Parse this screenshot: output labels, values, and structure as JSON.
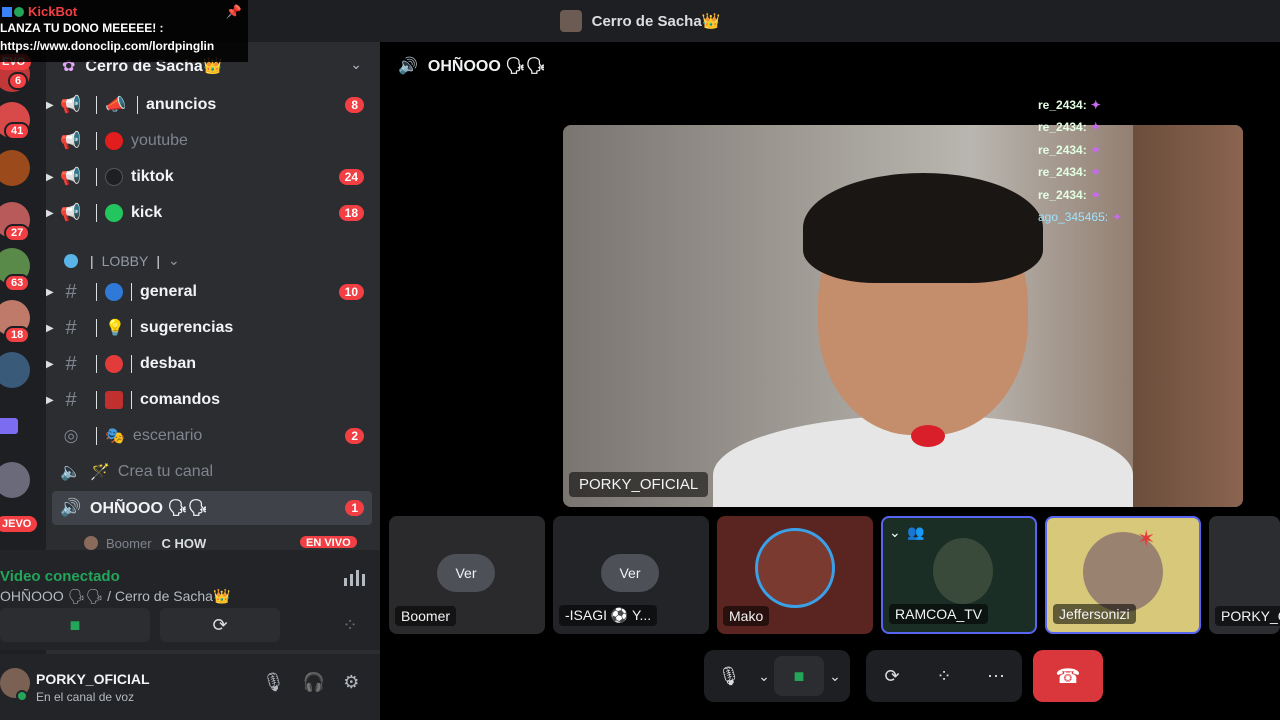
{
  "window": {
    "title": "Cerro de Sacha👑"
  },
  "kickbot": {
    "name": "KickBot",
    "line1": "LANZA TU DONO MEEEEE! :",
    "line2": "https://www.donoclip.com/lordpinglin"
  },
  "rail": {
    "badges": [
      "6",
      "41",
      "27",
      "63",
      "18"
    ],
    "nuevo_top": "EVO",
    "nuevo_bottom": "JEVO"
  },
  "sidebar": {
    "guild_name": "Cerro de Sacha👑",
    "lobby_label": "LOBBY",
    "channels": [
      {
        "name": "anuncios",
        "count": "8"
      },
      {
        "name": "youtube",
        "count": ""
      },
      {
        "name": "tiktok",
        "count": "24"
      },
      {
        "name": "kick",
        "count": "18"
      },
      {
        "name": "general",
        "count": "10"
      },
      {
        "name": "sugerencias",
        "count": ""
      },
      {
        "name": "desban",
        "count": ""
      },
      {
        "name": "comandos",
        "count": ""
      },
      {
        "name": "escenario",
        "count": "2"
      },
      {
        "name": "Crea tu canal",
        "count": ""
      },
      {
        "name": "OHÑOOO 🗣🗣",
        "count": "1"
      }
    ],
    "sub_item": "Boomer",
    "sub_item_game": "C HOW",
    "envivo": "EN VIVO"
  },
  "voice_panel": {
    "status": "Video conectado",
    "location": "OHÑOOO 🗣🗣 / Cerro de Sacha👑"
  },
  "user_panel": {
    "username": "PORKY_OFICIAL",
    "status": "En el canal de voz"
  },
  "stage": {
    "channel_title": "OHÑOOO 🗣🗣",
    "chat": [
      {
        "user": "re_2434:"
      },
      {
        "user": "re_2434:"
      },
      {
        "user": "re_2434:"
      },
      {
        "user": "re_2434:"
      },
      {
        "user": "re_2434:"
      },
      {
        "user": "ago_345465:"
      }
    ],
    "main_video_label": "PORKY_OFICIAL",
    "tiles": [
      {
        "label": "Boomer",
        "action": "Ver"
      },
      {
        "label": "-ISAGI ⚽ Y...",
        "action": "Ver"
      },
      {
        "label": "Mako",
        "action": ""
      },
      {
        "label": "RAMCOA_TV",
        "action": ""
      },
      {
        "label": "Jeffersonizi",
        "action": ""
      },
      {
        "label": "PORKY_O",
        "action": ""
      }
    ]
  },
  "colors": {
    "danger": "#da373c",
    "online": "#23a55a",
    "accent": "#5865f2"
  }
}
